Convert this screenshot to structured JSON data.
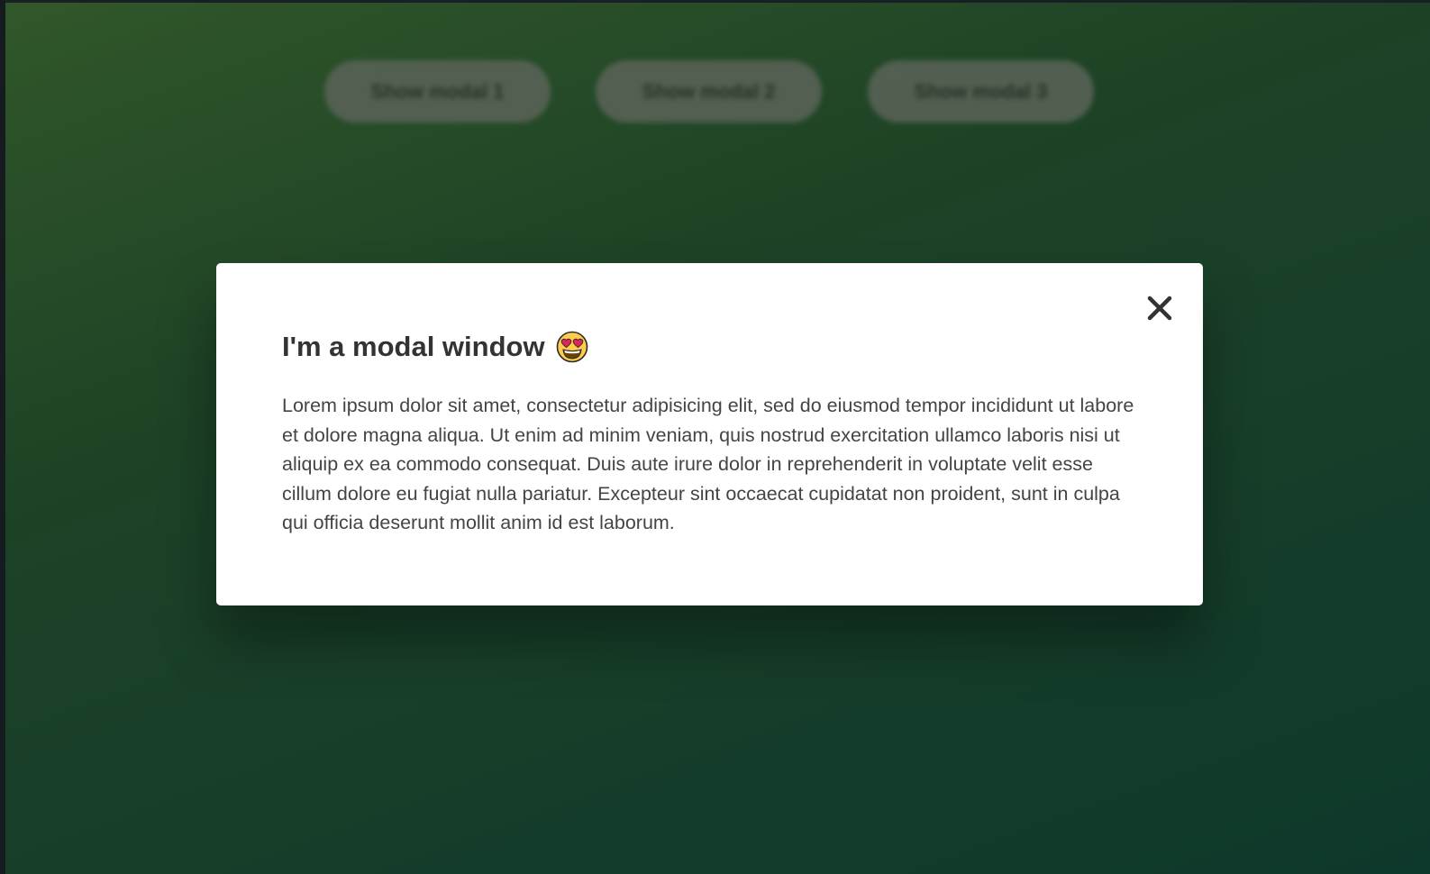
{
  "buttons": [
    {
      "label": "Show modal 1"
    },
    {
      "label": "Show modal 2"
    },
    {
      "label": "Show modal 3"
    }
  ],
  "modal": {
    "title": "I'm a modal window",
    "title_emoji": "smiling-face-with-heart-eyes-emoji",
    "body": "Lorem ipsum dolor sit amet, consectetur adipisicing elit, sed do eiusmod tempor incididunt ut labore et dolore magna aliqua. Ut enim ad minim veniam, quis nostrud exercitation ullamco laboris nisi ut aliquip ex ea commodo consequat. Duis aute irure dolor in reprehenderit in voluptate velit esse cillum dolore eu fugiat nulla pariatur. Excepteur sint occaecat cupidatat non proident, sunt in culpa qui officia deserunt mollit anim id est laborum.",
    "close_icon": "close-icon"
  },
  "colors": {
    "background_start": "#3c6a33",
    "background_end": "#124535",
    "modal_bg": "#ffffff",
    "title_text": "#333333",
    "body_text": "#444444"
  }
}
